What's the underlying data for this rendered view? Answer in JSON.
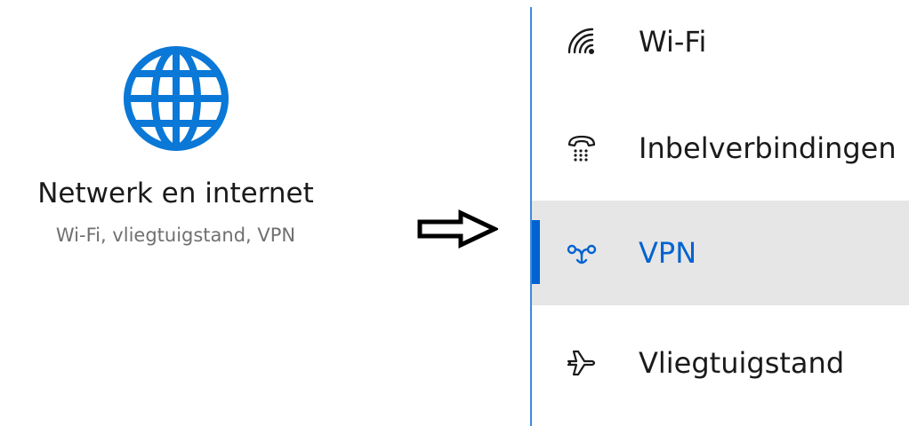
{
  "colors": {
    "accent": "#0063d1",
    "globe": "#0a78d7",
    "selected_background": "#e6e6e6",
    "divider": "#3c8bd9"
  },
  "tile": {
    "icon": "globe-icon",
    "title": "Netwerk en internet",
    "subtitle": "Wi-Fi, vliegtuigstand, VPN"
  },
  "arrow": {
    "icon": "arrow-right-icon"
  },
  "nav": {
    "items": [
      {
        "label": "Wi-Fi",
        "icon": "wifi-icon",
        "selected": false
      },
      {
        "label": "Inbelverbindingen",
        "icon": "dialup-phone-icon",
        "selected": false
      },
      {
        "label": "VPN",
        "icon": "vpn-icon",
        "selected": true
      },
      {
        "label": "Vliegtuigstand",
        "icon": "airplane-icon",
        "selected": false
      }
    ]
  }
}
